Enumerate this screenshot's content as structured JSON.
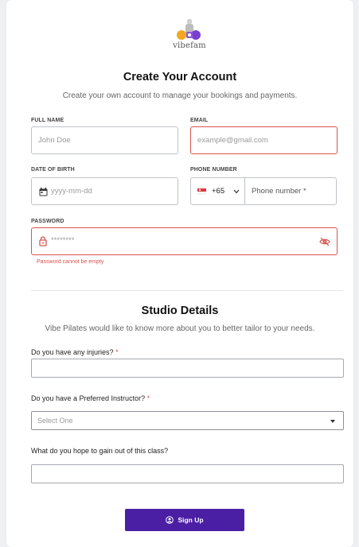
{
  "brand": {
    "name": "vibefam",
    "icon": "vibefam-logo"
  },
  "header": {
    "title": "Create Your Account",
    "subtitle": "Create your own account to manage your bookings and payments."
  },
  "form": {
    "full_name": {
      "label": "FULL NAME",
      "placeholder": "John Doe",
      "value": ""
    },
    "email": {
      "label": "EMAIL",
      "placeholder": "example@gmail.com",
      "value": ""
    },
    "dob": {
      "label": "DATE OF BIRTH",
      "placeholder": "yyyy-mm-dd",
      "icon": "calendar-icon"
    },
    "phone": {
      "label": "PHONE NUMBER",
      "country_code": "+65",
      "placeholder": "Phone number *",
      "flag": "singapore-flag-icon"
    },
    "password": {
      "label": "PASSWORD",
      "placeholder": "********",
      "error": "Password cannot be empty",
      "icons": [
        "lock-icon",
        "eye-off-icon"
      ]
    }
  },
  "studio": {
    "title": "Studio Details",
    "subtitle": "Vibe Pilates would like to know more about you to better tailor to your needs.",
    "injuries": {
      "label": "Do you have any injuries?",
      "required": "*"
    },
    "instructor": {
      "label": "Do you have a Preferred Instructor?",
      "required": "*",
      "selected": "Select One"
    },
    "goals": {
      "label": "What do you hope to gain out of this class?"
    }
  },
  "submit": {
    "label": "Sign Up",
    "icon": "user-circle-icon"
  },
  "colors": {
    "primary": "#4a1fa3",
    "error": "#d9534f",
    "border": "#bfc3c8"
  }
}
